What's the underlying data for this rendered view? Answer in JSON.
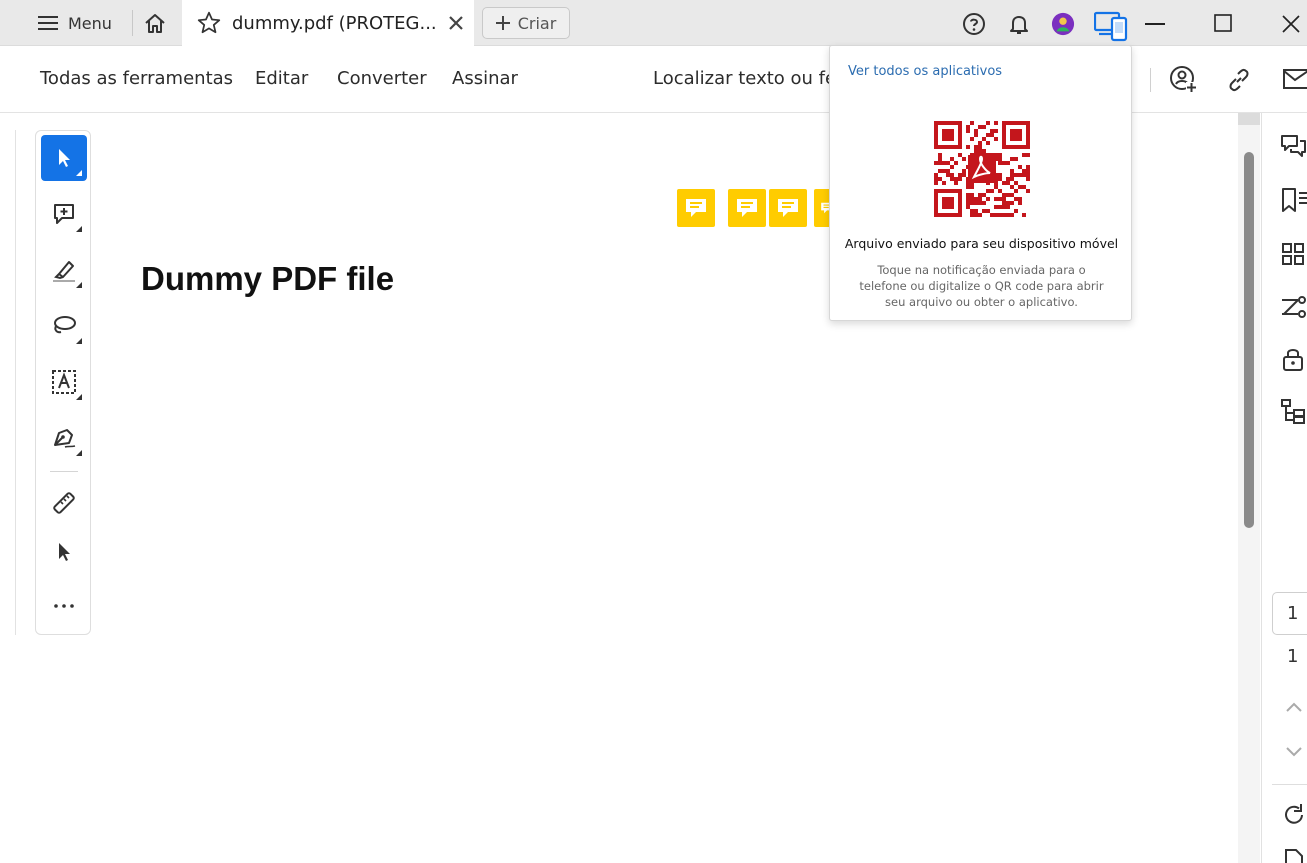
{
  "titlebar": {
    "menu_label": "Menu",
    "tab_title": "dummy.pdf (PROTEG...",
    "create_label": "Criar",
    "icons": [
      "help-icon",
      "bell-icon",
      "avatar",
      "devices-icon",
      "minimize-icon",
      "maximize-icon",
      "close-icon"
    ]
  },
  "toolbar": {
    "all_tools": "Todas as ferramentas",
    "edit": "Editar",
    "convert": "Converter",
    "sign": "Assinar",
    "find_text": "Localizar texto ou ferramentas"
  },
  "quick_tools": [
    "select-tool",
    "add-comment-tool",
    "highlight-tool",
    "draw-tool",
    "text-select-tool",
    "fill-sign-tool",
    "measure-tool",
    "cursor-tool",
    "more-tools"
  ],
  "document": {
    "title": "Dummy PDF file"
  },
  "pagination": {
    "current": "1",
    "total": "1"
  },
  "popup": {
    "link": "Ver todos os aplicativos",
    "heading": "Arquivo enviado para seu dispositivo móvel",
    "body": "Toque na notificação enviada para o telefone ou digitalize o QR code para abrir seu arquivo ou obter o aplicativo."
  },
  "colors": {
    "accent": "#1473e6",
    "note_yellow": "#ffcc00",
    "qr_red": "#c4161c",
    "link_blue": "#2b6cb0"
  }
}
